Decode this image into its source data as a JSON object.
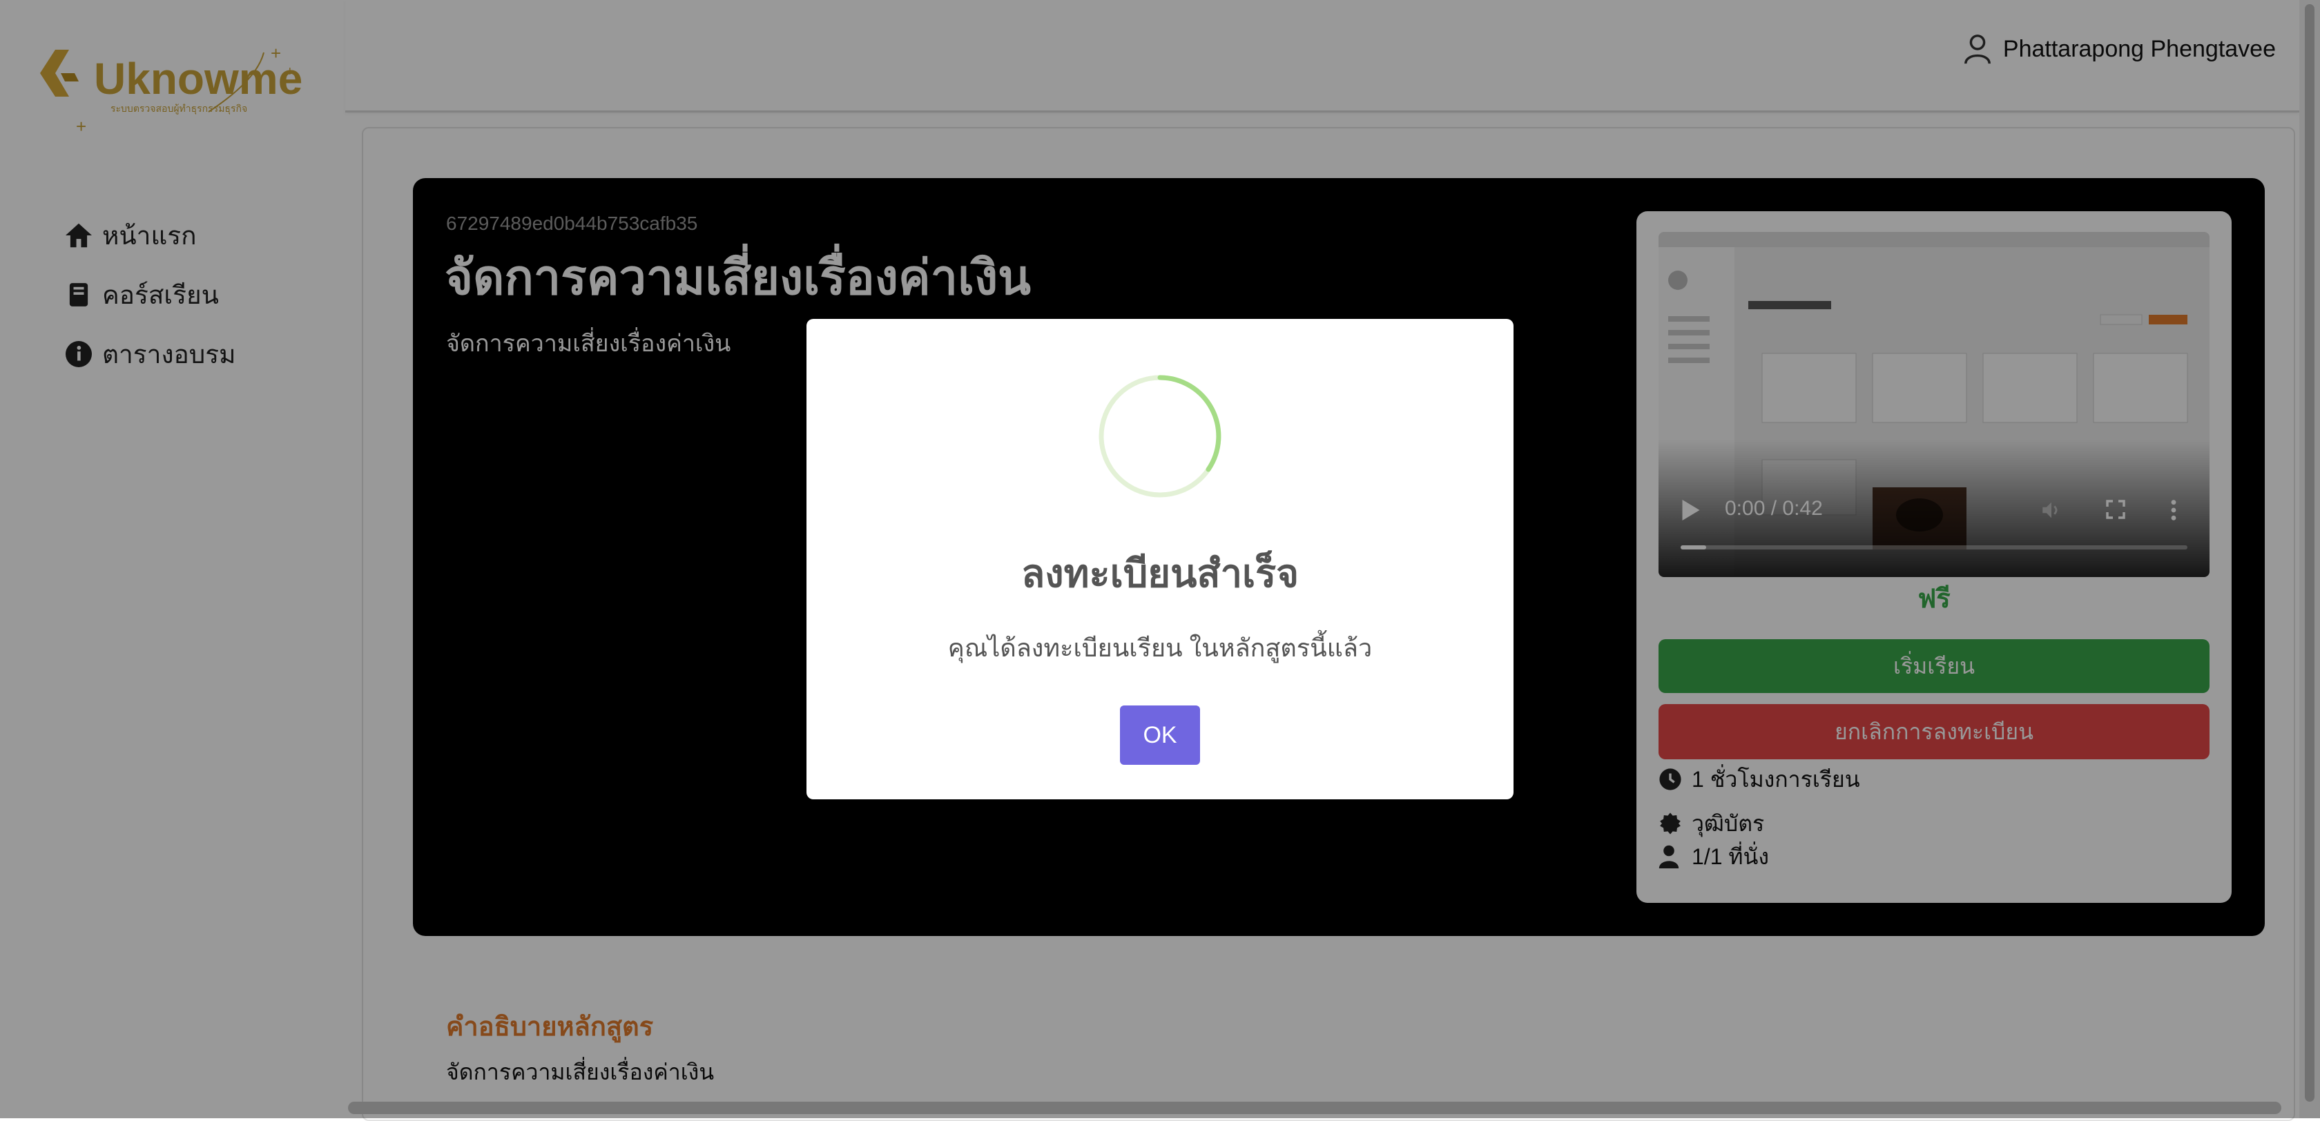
{
  "header": {
    "user_name": "Phattarapong Phengtavee",
    "user_icon": "user-icon"
  },
  "sidebar": {
    "logo_text": "Uknowme",
    "logo_tagline": "ระบบตรวจสอบผู้ทำธุรกรรมธุรกิจ",
    "items": [
      {
        "label": "หน้าแรก",
        "icon": "home-icon"
      },
      {
        "label": "คอร์สเรียน",
        "icon": "book-icon"
      },
      {
        "label": "ตารางอบรม",
        "icon": "info-icon"
      }
    ]
  },
  "course": {
    "id": "67297489ed0b44b753cafb35",
    "title": "จัดการความเสี่ยงเรื่องค่าเงิน",
    "subtitle": "จัดการความเสี่ยงเรื่องค่าเงิน",
    "video": {
      "time": "0:00 / 0:42",
      "progress_fraction": 0.05
    },
    "price": "ฟรี",
    "start_label": "เริ่มเรียน",
    "cancel_label": "ยกเลิกการลงทะเบียน",
    "meta": [
      {
        "text": "1 ชั่วโมงการเรียน",
        "icon": "clock-icon"
      },
      {
        "text": "วุฒิบัตร",
        "icon": "badge-icon"
      },
      {
        "text": "1/1 ที่นั่ง",
        "icon": "person-icon"
      }
    ]
  },
  "description": {
    "heading": "คำอธิบายหลักสูตร",
    "body": "จัดการความเสี่ยงเรื่องค่าเงิน"
  },
  "modal": {
    "title": "ลงทะเบียนสำเร็จ",
    "text": "คุณได้ลงทะเบียนเรียน ในหลักสูตรนี้แล้ว",
    "ok_label": "OK"
  },
  "colors": {
    "accent_orange": "#e07a2c",
    "logo_gold": "#c9a23a",
    "start_green": "#3aa64a",
    "cancel_red": "#e34646",
    "ok_purple": "#7066e0"
  }
}
